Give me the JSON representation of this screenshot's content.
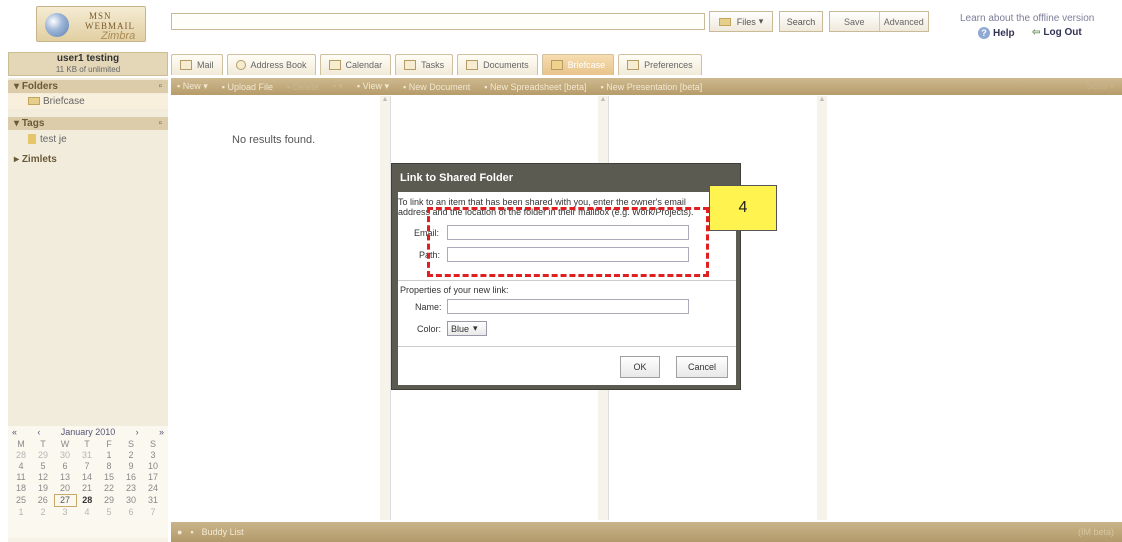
{
  "header": {
    "logo_line1": "MSN",
    "logo_line2": "WEBMAIL",
    "logo_line3": "Zimbra",
    "files_label": "Files",
    "search_label": "Search",
    "save_label": "Save",
    "advanced_label": "Advanced",
    "offline_text": "Learn about the offline version",
    "help_label": "Help",
    "logout_label": "Log Out"
  },
  "user": {
    "name": "user1 testing",
    "quota": "11 KB of unlimited"
  },
  "sidebar": {
    "folders_label": "Folders",
    "folder_items": [
      "Briefcase"
    ],
    "tags_label": "Tags",
    "tag_items": [
      "test je"
    ],
    "zimlets_label": "Zimlets"
  },
  "calendar": {
    "month": "January 2010",
    "weekdays": [
      "M",
      "T",
      "W",
      "T",
      "F",
      "S",
      "S"
    ],
    "rows": [
      [
        "28",
        "29",
        "30",
        "31",
        "1",
        "2",
        "3"
      ],
      [
        "4",
        "5",
        "6",
        "7",
        "8",
        "9",
        "10"
      ],
      [
        "11",
        "12",
        "13",
        "14",
        "15",
        "16",
        "17"
      ],
      [
        "18",
        "19",
        "20",
        "21",
        "22",
        "23",
        "24"
      ],
      [
        "25",
        "26",
        "27",
        "28",
        "29",
        "30",
        "31"
      ],
      [
        "1",
        "2",
        "3",
        "4",
        "5",
        "6",
        "7"
      ]
    ]
  },
  "tabs": [
    {
      "label": "Mail"
    },
    {
      "label": "Address Book"
    },
    {
      "label": "Calendar"
    },
    {
      "label": "Tasks"
    },
    {
      "label": "Documents"
    },
    {
      "label": "Briefcase"
    },
    {
      "label": "Preferences"
    }
  ],
  "toolbar": {
    "new": "New",
    "upload": "Upload File",
    "delete": "Delete",
    "view": "View",
    "new_document": "New Document",
    "new_spreadsheet": "New Spreadsheet [beta]",
    "new_presentation": "New Presentation [beta]",
    "send": "Send"
  },
  "content": {
    "no_results": "No results found."
  },
  "bottom": {
    "buddy_list": "Buddy List",
    "im": "(IM beta)"
  },
  "dialog": {
    "title": "Link to Shared Folder",
    "desc_line1": "To link to an item that has been shared with you, enter the owner's email",
    "desc_line2": "address and the location of the folder in their mailbox (e.g. Work/Projects).",
    "email_label": "Email:",
    "path_label": "Path:",
    "properties_label": "Properties of your new link:",
    "name_label": "Name:",
    "color_label": "Color:",
    "color_value": "Blue",
    "ok": "OK",
    "cancel": "Cancel"
  },
  "annotation": {
    "callout_number": "4"
  }
}
